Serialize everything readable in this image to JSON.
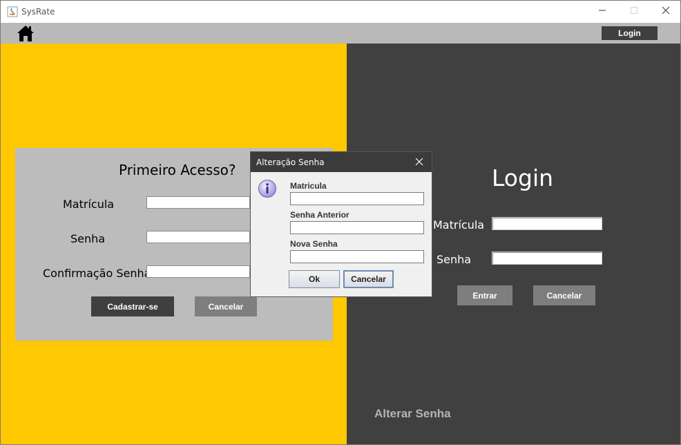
{
  "window": {
    "title": "SysRate"
  },
  "navbar": {
    "login_label": "Login"
  },
  "first_access": {
    "title": "Primeiro Acesso?",
    "matricula_label": "Matrícula",
    "senha_label": "Senha",
    "confirmacao_label": "Confirmação Senha",
    "cadastrar_label": "Cadastrar-se",
    "cancelar_label": "Cancelar"
  },
  "login": {
    "title": "Login",
    "matricula_label": "Matrícula",
    "senha_label": "Senha",
    "entrar_label": "Entrar",
    "cancelar_label": "Cancelar",
    "alterar_senha_label": "Alterar Senha"
  },
  "dialog": {
    "title": "Alteração Senha",
    "matricula_label": "Matricula",
    "senha_anterior_label": "Senha Anterior",
    "nova_senha_label": "Nova Senha",
    "ok_label": "Ok",
    "cancelar_label": "Cancelar"
  },
  "colors": {
    "left_panel": "#ffc800",
    "right_panel": "#404040",
    "navbar": "#b9b9b9",
    "card": "#bcbcbc"
  },
  "icons": [
    "java-app-icon",
    "home-icon",
    "minimize-icon",
    "maximize-icon",
    "close-icon",
    "info-icon"
  ]
}
